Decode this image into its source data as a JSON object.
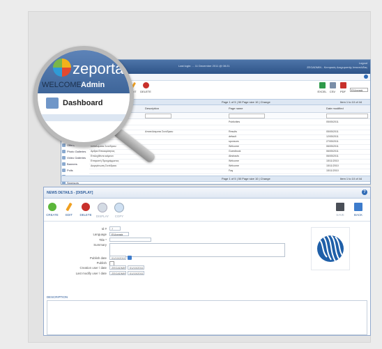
{
  "magnifier": {
    "brand": "zeportal",
    "welcome": "WELCOME",
    "admin": "Admin",
    "dashboard": "Dashboard"
  },
  "top_window": {
    "login_text": "Last login: ... 11 December 2011 @ 08:21",
    "header_right_line1": "Logout",
    "header_right_line2": "ZEGADMIN - Κεντρικός Διαχειριστής Ιστοσελίδας",
    "toolbar": {
      "add": "ADD",
      "edit": "EDIT",
      "delete": "DELETE",
      "excel": "EXCEL",
      "csv": "CSV",
      "pdf": "PDF",
      "language": "Ελληνικά"
    },
    "pager_text": "Page 1 of 5 | 50 Page size 10 | Change",
    "items_text": "Item 1 to 10 of 44",
    "columns": [
      "Description",
      "Page name",
      "Date modified"
    ],
    "rows": [
      {
        "title": "Προσφορές Προσφορών",
        "description": "",
        "page": "Publicities",
        "date": "05/05/2011"
      },
      {
        "title": "Προσφορές Ανακοινώσεις",
        "description": "",
        "page": "",
        "date": ""
      },
      {
        "title": "Αποτελέσματα Συνέδριου",
        "description": "Αποτελέσματα Συνέδριου",
        "page": "Results",
        "date": "05/05/2011"
      },
      {
        "title": "Επικοινωνήστε",
        "description": "",
        "page": "default",
        "date": "12/05/2011"
      },
      {
        "title": "Χορηγίες",
        "description": "",
        "page": "sponsors",
        "date": "27/05/2011"
      },
      {
        "title": "Καταλυματα Συνέδριου",
        "description": "",
        "page": "Welcome",
        "date": "06/05/2011"
      },
      {
        "title": "Αρθρα Επικαιρότητας",
        "description": "",
        "page": "Guestbook",
        "date": "06/05/2011"
      },
      {
        "title": "Επιλεχθέντα κείμενα",
        "description": "",
        "page": "Abstracts",
        "date": "06/05/2011"
      },
      {
        "title": "Επιτροπή Προγράμματος",
        "description": "",
        "page": "Welcome",
        "date": "15/11/2010"
      },
      {
        "title": "Διοργάνωση Συνέδριου",
        "description": "",
        "page": "Welcome",
        "date": "15/11/2010"
      },
      {
        "title": "",
        "description": "",
        "page": "Faq",
        "date": "15/11/2010"
      }
    ],
    "sidebar": [
      "Submit",
      "Offers",
      "Photo Galleries",
      "Video Galleries",
      "Banners",
      "Polls",
      "Testimonials",
      "Sponsors",
      "Forums",
      "Articles",
      "FAQ"
    ]
  },
  "bottom_window": {
    "title": "NEWS DETAILS - [DISPLAY]",
    "tools": {
      "create": "CREATE",
      "edit": "EDIT",
      "delete": "DELETE",
      "display": "DISPLAY",
      "copy": "COPY",
      "save": "SAVE",
      "back": "BACK"
    },
    "labels": {
      "id": "Id #",
      "language": "Language",
      "title": "Title *",
      "summary": "Summary",
      "publish_date": "Publish date",
      "publish": "Publish",
      "creation_user_date": "Creation user / date",
      "last_modify_user_date": "Last modify user / date",
      "description": "DESCRIPTION"
    },
    "values": {
      "id": "7",
      "language": "Ελληνικά",
      "title": "",
      "publish_date": "01/10/2011",
      "creation_user": "ZEGADMIN",
      "creation_date": "01/10/2011",
      "modify_user": "ZEGADMIN",
      "modify_date": "01/10/2011"
    }
  },
  "colors": {
    "header_blue": "#3e6599",
    "accent_blue": "#2d5c9a",
    "create_green": "#5bb63a",
    "delete_red": "#c8302b",
    "edit_orange": "#f0a020"
  }
}
